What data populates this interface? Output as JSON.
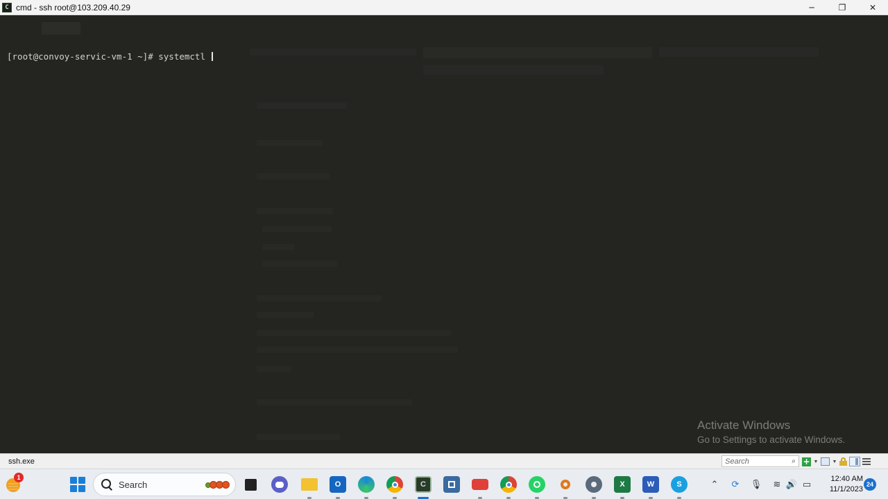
{
  "window": {
    "title": "cmd - ssh  root@103.209.40.29",
    "minimize": "─",
    "restore": "❐",
    "close": "✕"
  },
  "terminal": {
    "prompt": "[root@convoy-servic-vm-1 ~]# ",
    "command": "systemctl "
  },
  "watermark": {
    "title": "Activate Windows",
    "subtitle": "Go to Settings to activate Windows."
  },
  "statusbar": {
    "process": "ssh.exe",
    "search_placeholder": "Search"
  },
  "taskbar": {
    "weather_badge": "1",
    "search_label": "Search",
    "apps": [
      {
        "name": "file-manager",
        "icon": "file-manager-icon",
        "color": "#222222"
      },
      {
        "name": "teams",
        "icon": "teams-chat-icon",
        "color": "#5b5fc7"
      },
      {
        "name": "file-explorer",
        "icon": "folder-icon",
        "color": "#f2c230"
      },
      {
        "name": "outlook",
        "icon": "outlook-icon",
        "color": "#1466c0"
      },
      {
        "name": "edge",
        "icon": "edge-icon",
        "color": "#1a8ad4"
      },
      {
        "name": "chrome",
        "icon": "chrome-icon",
        "color": "#db4437"
      },
      {
        "name": "conemu",
        "icon": "terminal-icon",
        "color": "#2a3a2a"
      },
      {
        "name": "snip-tool",
        "icon": "snip-icon",
        "color": "#3a6aa0"
      },
      {
        "name": "screen-recorder",
        "icon": "camera-icon",
        "color": "#e0403a"
      },
      {
        "name": "chrome-profile",
        "icon": "chrome-profile-icon",
        "color": "#db4437"
      },
      {
        "name": "whatsapp",
        "icon": "whatsapp-icon",
        "color": "#25d366"
      },
      {
        "name": "search-tool",
        "icon": "magnifier-icon",
        "color": "#e07a1a"
      },
      {
        "name": "settings",
        "icon": "gear-icon",
        "color": "#5a6a7a"
      },
      {
        "name": "excel",
        "icon": "excel-icon",
        "color": "#1d7a45"
      },
      {
        "name": "word",
        "icon": "word-icon",
        "color": "#2b5cb8"
      },
      {
        "name": "skype",
        "icon": "skype-icon",
        "color": "#1aa0e0"
      }
    ],
    "app_letters": {
      "outlook": "O",
      "excel": "X",
      "word": "W",
      "skype": "S"
    },
    "time": "12:40 AM",
    "date": "11/1/2023",
    "notifications": "24"
  }
}
